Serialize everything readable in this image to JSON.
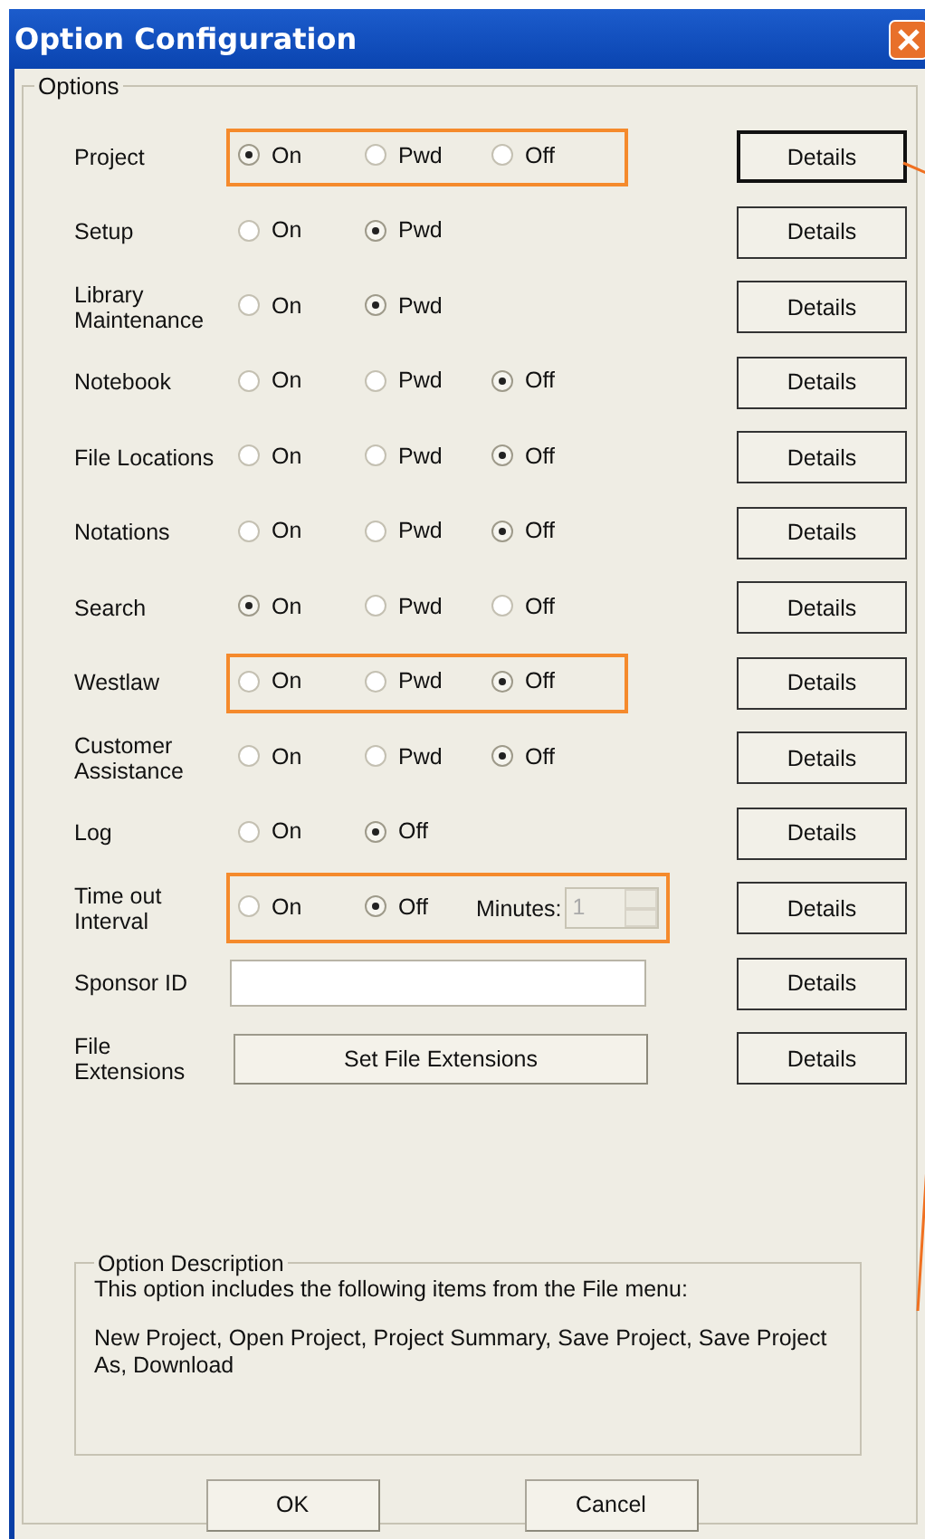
{
  "window": {
    "title": "Option Configuration"
  },
  "options_group": {
    "title": "Options"
  },
  "rows": [
    {
      "kind": "radio",
      "label": [
        "Project"
      ],
      "highlighted": true,
      "options": [
        {
          "label": "On",
          "selected": true
        },
        {
          "label": "Pwd",
          "selected": false
        },
        {
          "label": "Off",
          "selected": false
        }
      ],
      "details": {
        "label": "Details",
        "focused": true
      }
    },
    {
      "kind": "radio",
      "label": [
        "Setup"
      ],
      "highlighted": false,
      "options": [
        {
          "label": "On",
          "selected": false
        },
        {
          "label": "Pwd",
          "selected": true
        }
      ],
      "details": {
        "label": "Details",
        "focused": false
      }
    },
    {
      "kind": "radio",
      "label": [
        "Library",
        "Maintenance"
      ],
      "highlighted": false,
      "options": [
        {
          "label": "On",
          "selected": false
        },
        {
          "label": "Pwd",
          "selected": true
        }
      ],
      "details": {
        "label": "Details",
        "focused": false
      }
    },
    {
      "kind": "radio",
      "label": [
        "Notebook"
      ],
      "highlighted": false,
      "options": [
        {
          "label": "On",
          "selected": false
        },
        {
          "label": "Pwd",
          "selected": false
        },
        {
          "label": "Off",
          "selected": true
        }
      ],
      "details": {
        "label": "Details",
        "focused": false
      }
    },
    {
      "kind": "radio",
      "label": [
        "File Locations"
      ],
      "highlighted": false,
      "options": [
        {
          "label": "On",
          "selected": false
        },
        {
          "label": "Pwd",
          "selected": false
        },
        {
          "label": "Off",
          "selected": true
        }
      ],
      "details": {
        "label": "Details",
        "focused": false
      }
    },
    {
      "kind": "radio",
      "label": [
        "Notations"
      ],
      "highlighted": false,
      "options": [
        {
          "label": "On",
          "selected": false
        },
        {
          "label": "Pwd",
          "selected": false
        },
        {
          "label": "Off",
          "selected": true
        }
      ],
      "details": {
        "label": "Details",
        "focused": false
      }
    },
    {
      "kind": "radio",
      "label": [
        "Search"
      ],
      "highlighted": false,
      "options": [
        {
          "label": "On",
          "selected": true
        },
        {
          "label": "Pwd",
          "selected": false
        },
        {
          "label": "Off",
          "selected": false
        }
      ],
      "details": {
        "label": "Details",
        "focused": false
      }
    },
    {
      "kind": "radio",
      "label": [
        "Westlaw"
      ],
      "highlighted": true,
      "options": [
        {
          "label": "On",
          "selected": false
        },
        {
          "label": "Pwd",
          "selected": false
        },
        {
          "label": "Off",
          "selected": true
        }
      ],
      "details": {
        "label": "Details",
        "focused": false
      }
    },
    {
      "kind": "radio",
      "label": [
        "Customer",
        "Assistance"
      ],
      "highlighted": false,
      "options": [
        {
          "label": "On",
          "selected": false
        },
        {
          "label": "Pwd",
          "selected": false
        },
        {
          "label": "Off",
          "selected": true
        }
      ],
      "details": {
        "label": "Details",
        "focused": false
      }
    },
    {
      "kind": "radio",
      "label": [
        "Log"
      ],
      "highlighted": false,
      "options": [
        {
          "label": "On",
          "selected": false
        },
        {
          "label": "Off",
          "selected": true
        }
      ],
      "details": {
        "label": "Details",
        "focused": false
      }
    },
    {
      "kind": "timeout",
      "label": [
        "Time out",
        "Interval"
      ],
      "highlighted": true,
      "options": [
        {
          "label": "On",
          "selected": false
        },
        {
          "label": "Off",
          "selected": true
        }
      ],
      "minutes": {
        "label": "Minutes:",
        "value": "1",
        "disabled": true
      },
      "details": {
        "label": "Details",
        "focused": false
      }
    },
    {
      "kind": "text",
      "label": [
        "Sponsor ID"
      ],
      "highlighted": false,
      "details": {
        "label": "Details",
        "focused": false
      }
    },
    {
      "kind": "button",
      "label": [
        "File",
        "Extensions"
      ],
      "highlighted": false,
      "button": "Set File Extensions",
      "details": {
        "label": "Details",
        "focused": false
      }
    }
  ],
  "description": {
    "title": "Option Description",
    "lines": [
      "This option includes the following items from the File menu:",
      "New Project, Open Project, Project Summary, Save Project, Save Project As, Download"
    ]
  },
  "buttons": [
    "OK",
    "Cancel"
  ]
}
